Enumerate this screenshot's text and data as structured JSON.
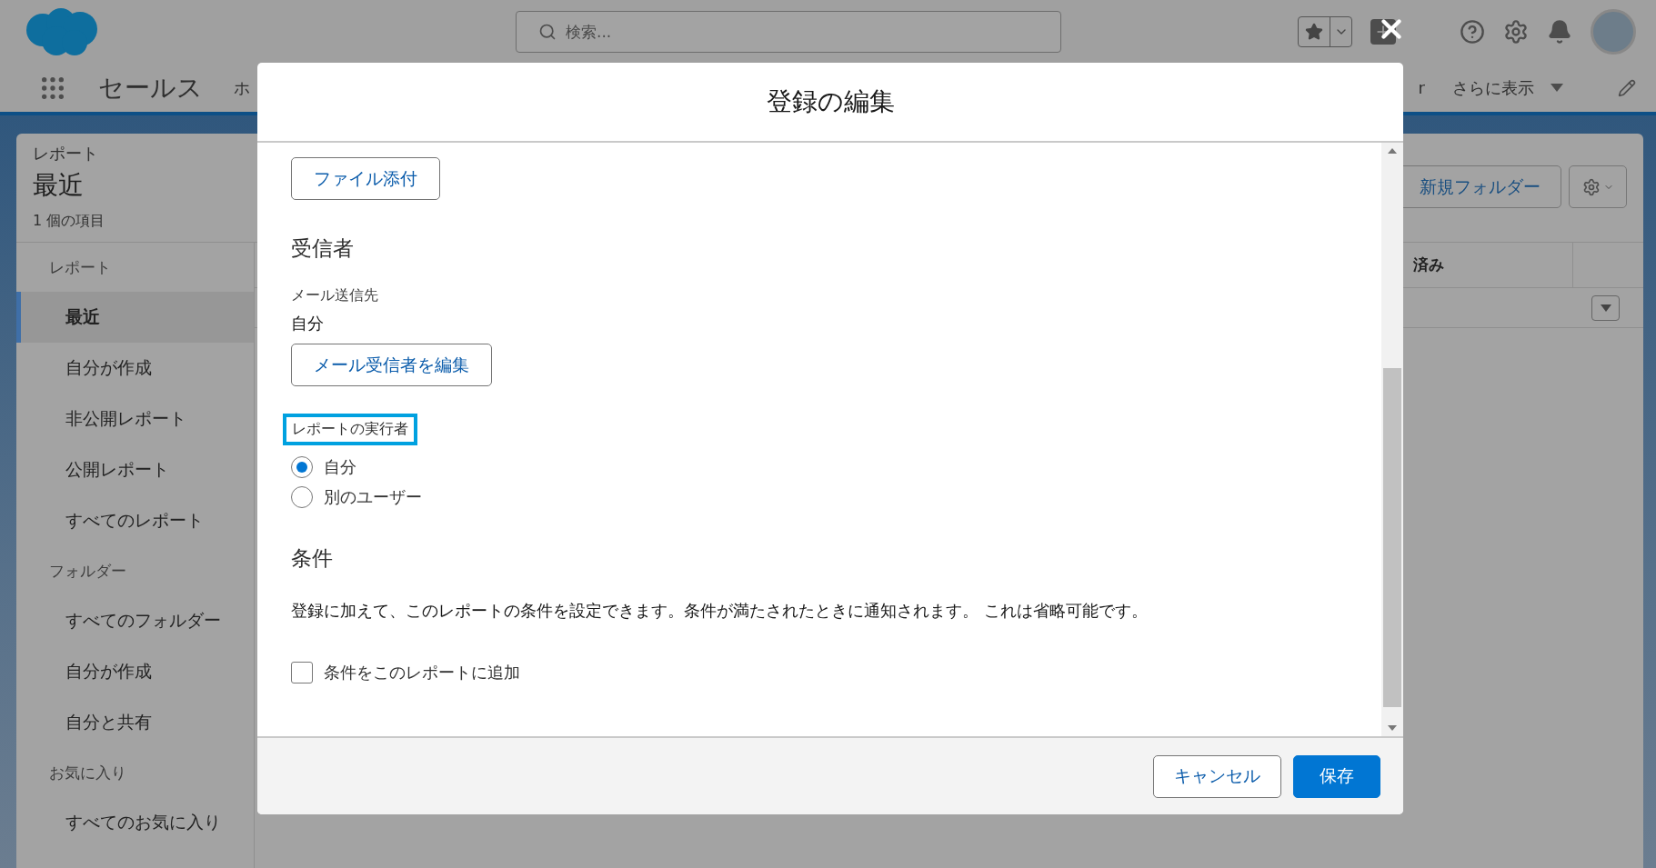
{
  "header": {
    "search_placeholder": "検索..."
  },
  "app_nav": {
    "app_name": "セールス",
    "items": [
      {
        "label": "ホ"
      },
      {
        "label": "r"
      }
    ],
    "more": "さらに表示"
  },
  "reports_panel": {
    "object": "レポート",
    "title": "最近",
    "count": "1 個の項目",
    "new_folder_button": "新規フォルダー",
    "column_header": "済み"
  },
  "sidebar": {
    "sections": [
      {
        "heading": "レポート",
        "items": [
          {
            "label": "最近",
            "selected": true
          },
          {
            "label": "自分が作成",
            "selected": false
          },
          {
            "label": "非公開レポート",
            "selected": false
          },
          {
            "label": "公開レポート",
            "selected": false
          },
          {
            "label": "すべてのレポート",
            "selected": false
          }
        ]
      },
      {
        "heading": "フォルダー",
        "items": [
          {
            "label": "すべてのフォルダー",
            "selected": false
          },
          {
            "label": "自分が作成",
            "selected": false
          },
          {
            "label": "自分と共有",
            "selected": false
          }
        ]
      },
      {
        "heading": "お気に入り",
        "items": [
          {
            "label": "すべてのお気に入り",
            "selected": false
          }
        ]
      }
    ]
  },
  "modal": {
    "title": "登録の編集",
    "attach_button": "ファイル添付",
    "recipients_heading": "受信者",
    "email_to_label": "メール送信先",
    "email_to_value": "自分",
    "edit_recipients_button": "メール受信者を編集",
    "run_as": {
      "label": "レポートの実行者",
      "options": [
        {
          "label": "自分",
          "selected": true
        },
        {
          "label": "別のユーザー",
          "selected": false
        }
      ]
    },
    "conditions_heading": "条件",
    "conditions_text": "登録に加えて、このレポートの条件を設定できます。条件が満たされたときに通知されます。 これは省略可能です。",
    "add_conditions": {
      "label": "条件をこのレポートに追加",
      "checked": false
    },
    "buttons": {
      "cancel": "キャンセル",
      "save": "保存"
    }
  }
}
